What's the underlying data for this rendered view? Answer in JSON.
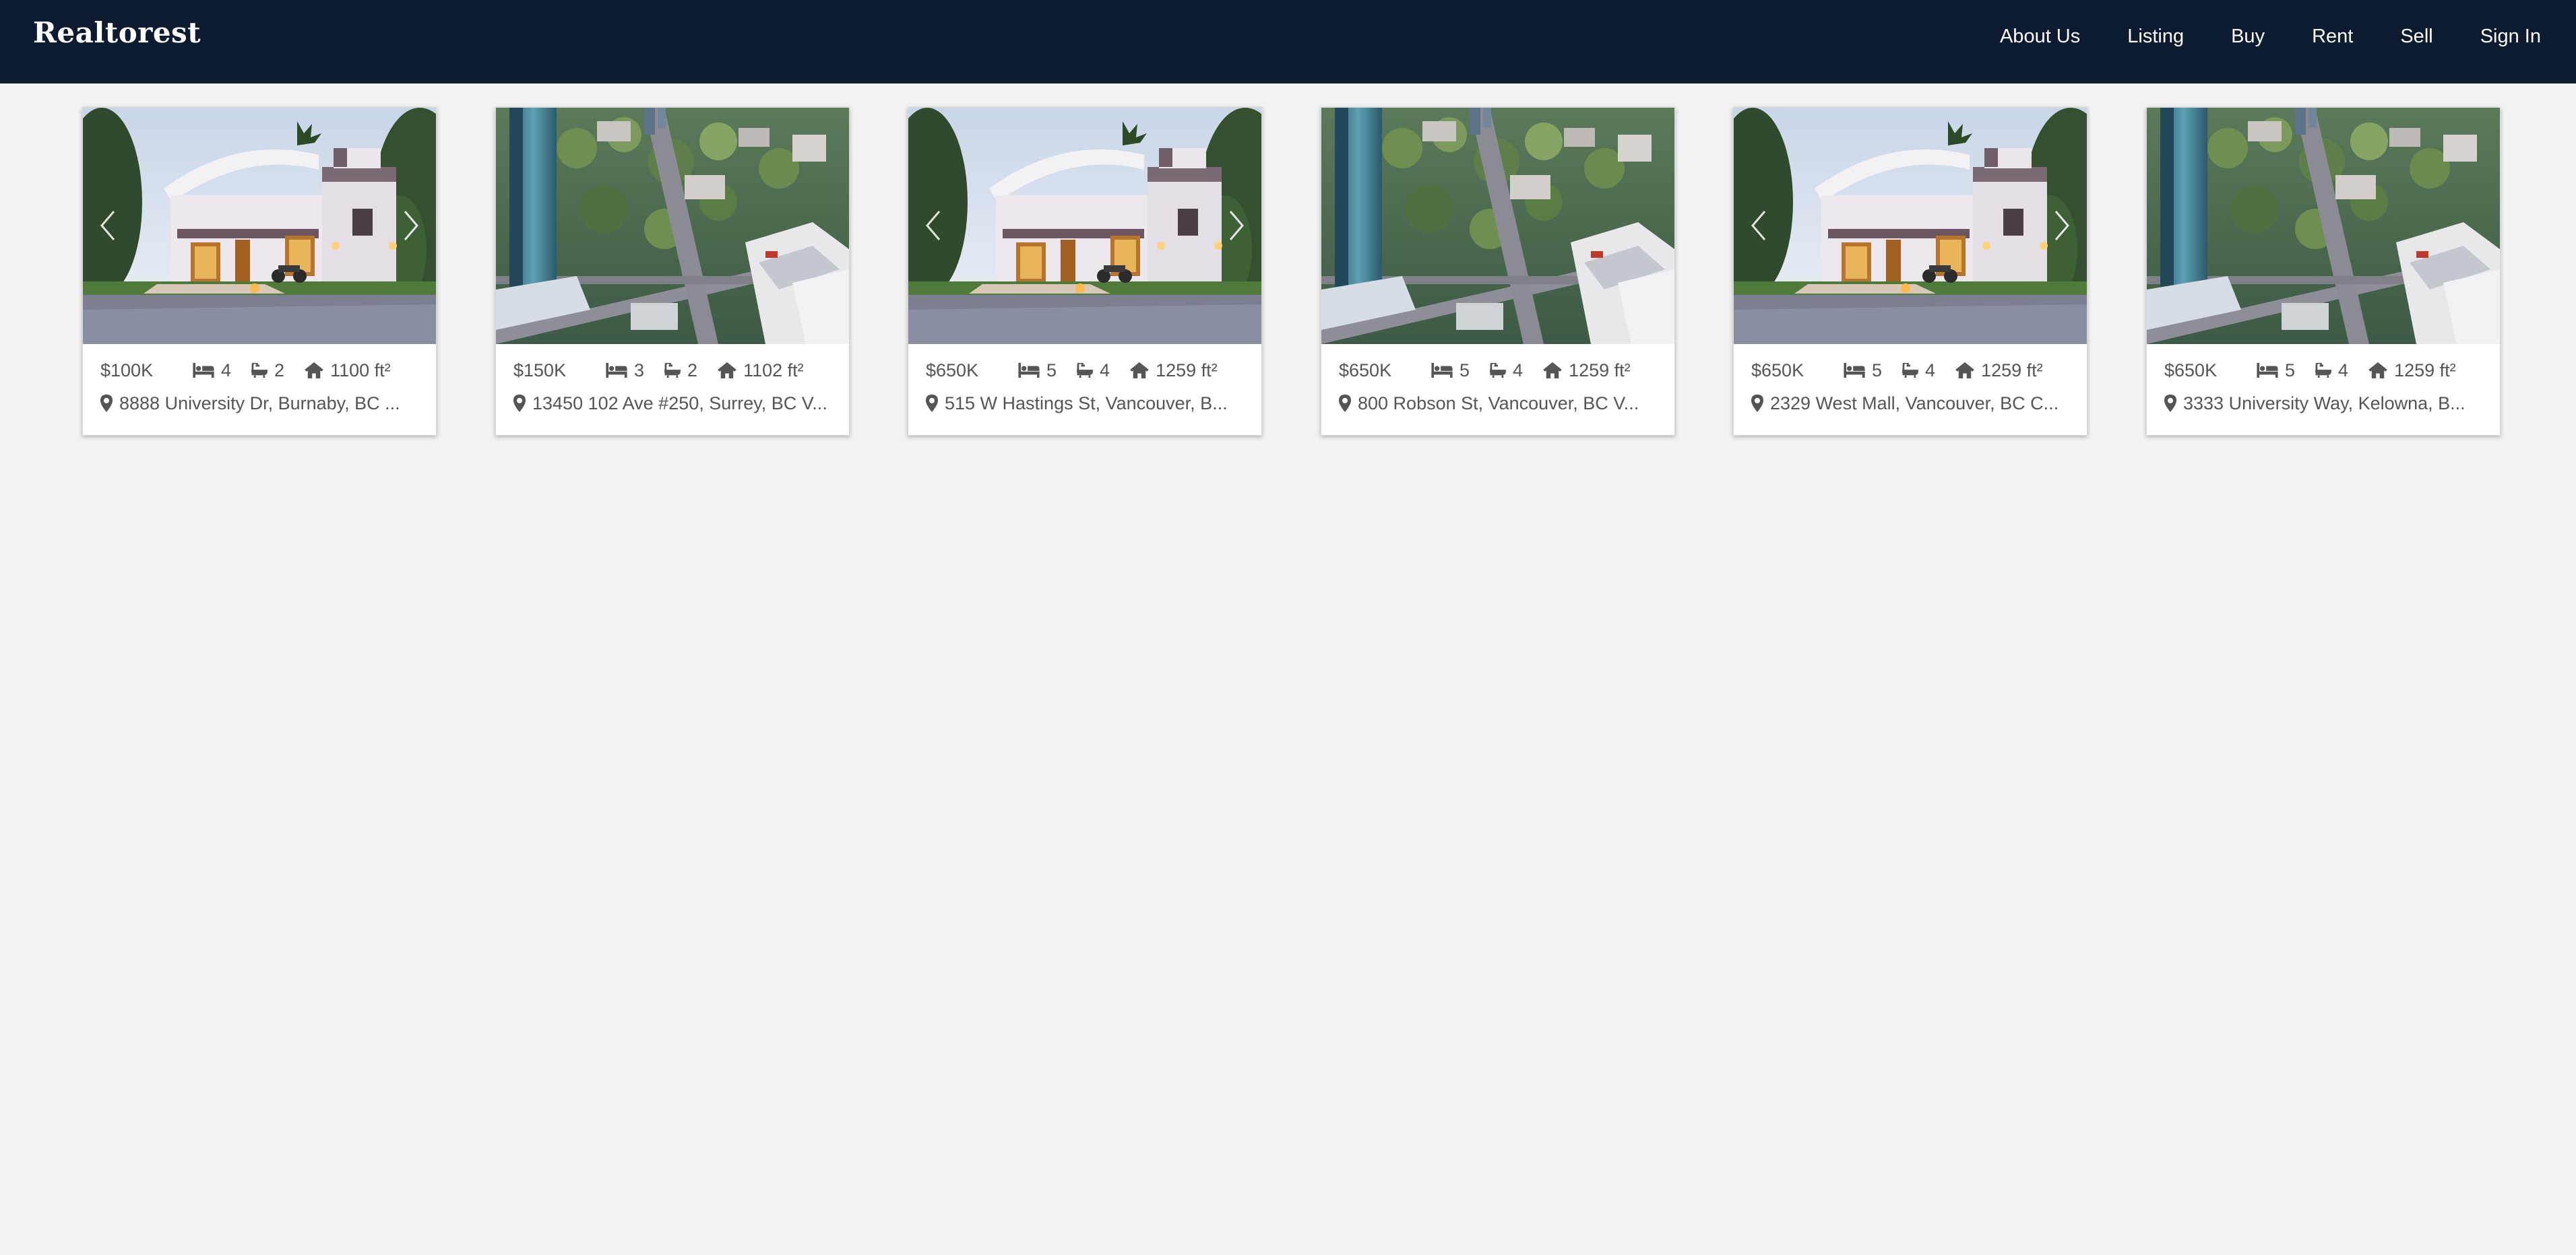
{
  "app": {
    "brand": "Realtorest"
  },
  "nav": [
    {
      "key": "about",
      "label": "About Us"
    },
    {
      "key": "listing",
      "label": "Listing"
    },
    {
      "key": "buy",
      "label": "Buy"
    },
    {
      "key": "rent",
      "label": "Rent"
    },
    {
      "key": "sell",
      "label": "Sell"
    },
    {
      "key": "signin",
      "label": "Sign In"
    }
  ],
  "icons": {
    "bed": "bed-icon",
    "bath": "bath-icon",
    "area": "home-icon",
    "location": "map-marker-icon",
    "prev": "chevron-left-icon",
    "next": "chevron-right-icon"
  },
  "colors": {
    "navbar": "#0e1a30",
    "page_background": "#f2f2f2",
    "card_background": "#ffffff",
    "text": "#555555"
  },
  "listings": [
    {
      "price": "$100K",
      "beds": "4",
      "baths": "2",
      "area": "1100 ft²",
      "address": "8888 University Dr, Burnaby, BC ...",
      "photo": "house"
    },
    {
      "price": "$150K",
      "beds": "3",
      "baths": "2",
      "area": "1102 ft²",
      "address": "13450 102 Ave #250, Surrey, BC V...",
      "photo": "city"
    },
    {
      "price": "$650K",
      "beds": "5",
      "baths": "4",
      "area": "1259 ft²",
      "address": "515 W Hastings St, Vancouver, B...",
      "photo": "house"
    },
    {
      "price": "$650K",
      "beds": "5",
      "baths": "4",
      "area": "1259 ft²",
      "address": "800 Robson St, Vancouver, BC V...",
      "photo": "city"
    },
    {
      "price": "$650K",
      "beds": "5",
      "baths": "4",
      "area": "1259 ft²",
      "address": "2329 West Mall, Vancouver, BC C...",
      "photo": "house"
    },
    {
      "price": "$650K",
      "beds": "5",
      "baths": "4",
      "area": "1259 ft²",
      "address": "3333 University Way, Kelowna, B...",
      "photo": "city"
    }
  ]
}
